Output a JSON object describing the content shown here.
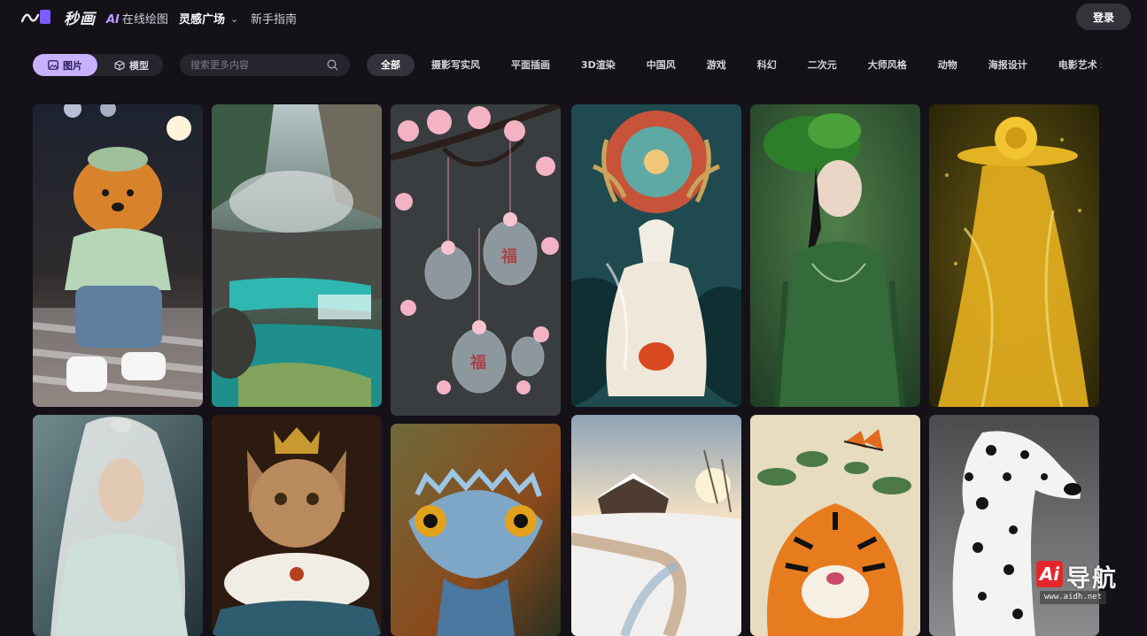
{
  "app": {
    "name": "秒画"
  },
  "nav": {
    "ai_badge": "AI",
    "ai_draw": "在线绘图",
    "inspiration": "灵感广场",
    "guide": "新手指南",
    "login": "登录"
  },
  "filters": {
    "type_tabs": [
      {
        "label": "图片",
        "icon": "image-icon",
        "active": true
      },
      {
        "label": "模型",
        "icon": "cube-icon",
        "active": false
      }
    ],
    "search": {
      "placeholder": "搜索更多内容",
      "value": ""
    },
    "categories": [
      "全部",
      "摄影写实风",
      "平面插画",
      "3D渲染",
      "中国风",
      "游戏",
      "科幻",
      "二次元",
      "大师风格",
      "动物",
      "海报设计",
      "电影艺术"
    ],
    "active_category": "全部",
    "more_indicator": ":"
  },
  "gallery": {
    "items": [
      {
        "subject": "pomeranian-in-sweater"
      },
      {
        "subject": "mountain-waterfall-pools"
      },
      {
        "subject": "cherry-blossom-glass-charms",
        "glyphs": [
          "福",
          "福"
        ]
      },
      {
        "subject": "jade-deer-relief"
      },
      {
        "subject": "woman-green-hanfu"
      },
      {
        "subject": "golden-rose-hat-figure"
      },
      {
        "subject": "white-haired-swordsman"
      },
      {
        "subject": "royal-cat-portrait"
      },
      {
        "subject": "blue-gecko-closeup"
      },
      {
        "subject": "snowy-cabin-landscape"
      },
      {
        "subject": "tiger-with-butterfly"
      },
      {
        "subject": "dalmatian-portrait"
      }
    ]
  },
  "watermark": {
    "badge": "Ai",
    "brand": "导航",
    "url": "www.aidh.net"
  },
  "colors": {
    "background": "#141218",
    "accent": "#c7b2ff",
    "chip": "#34323a"
  }
}
